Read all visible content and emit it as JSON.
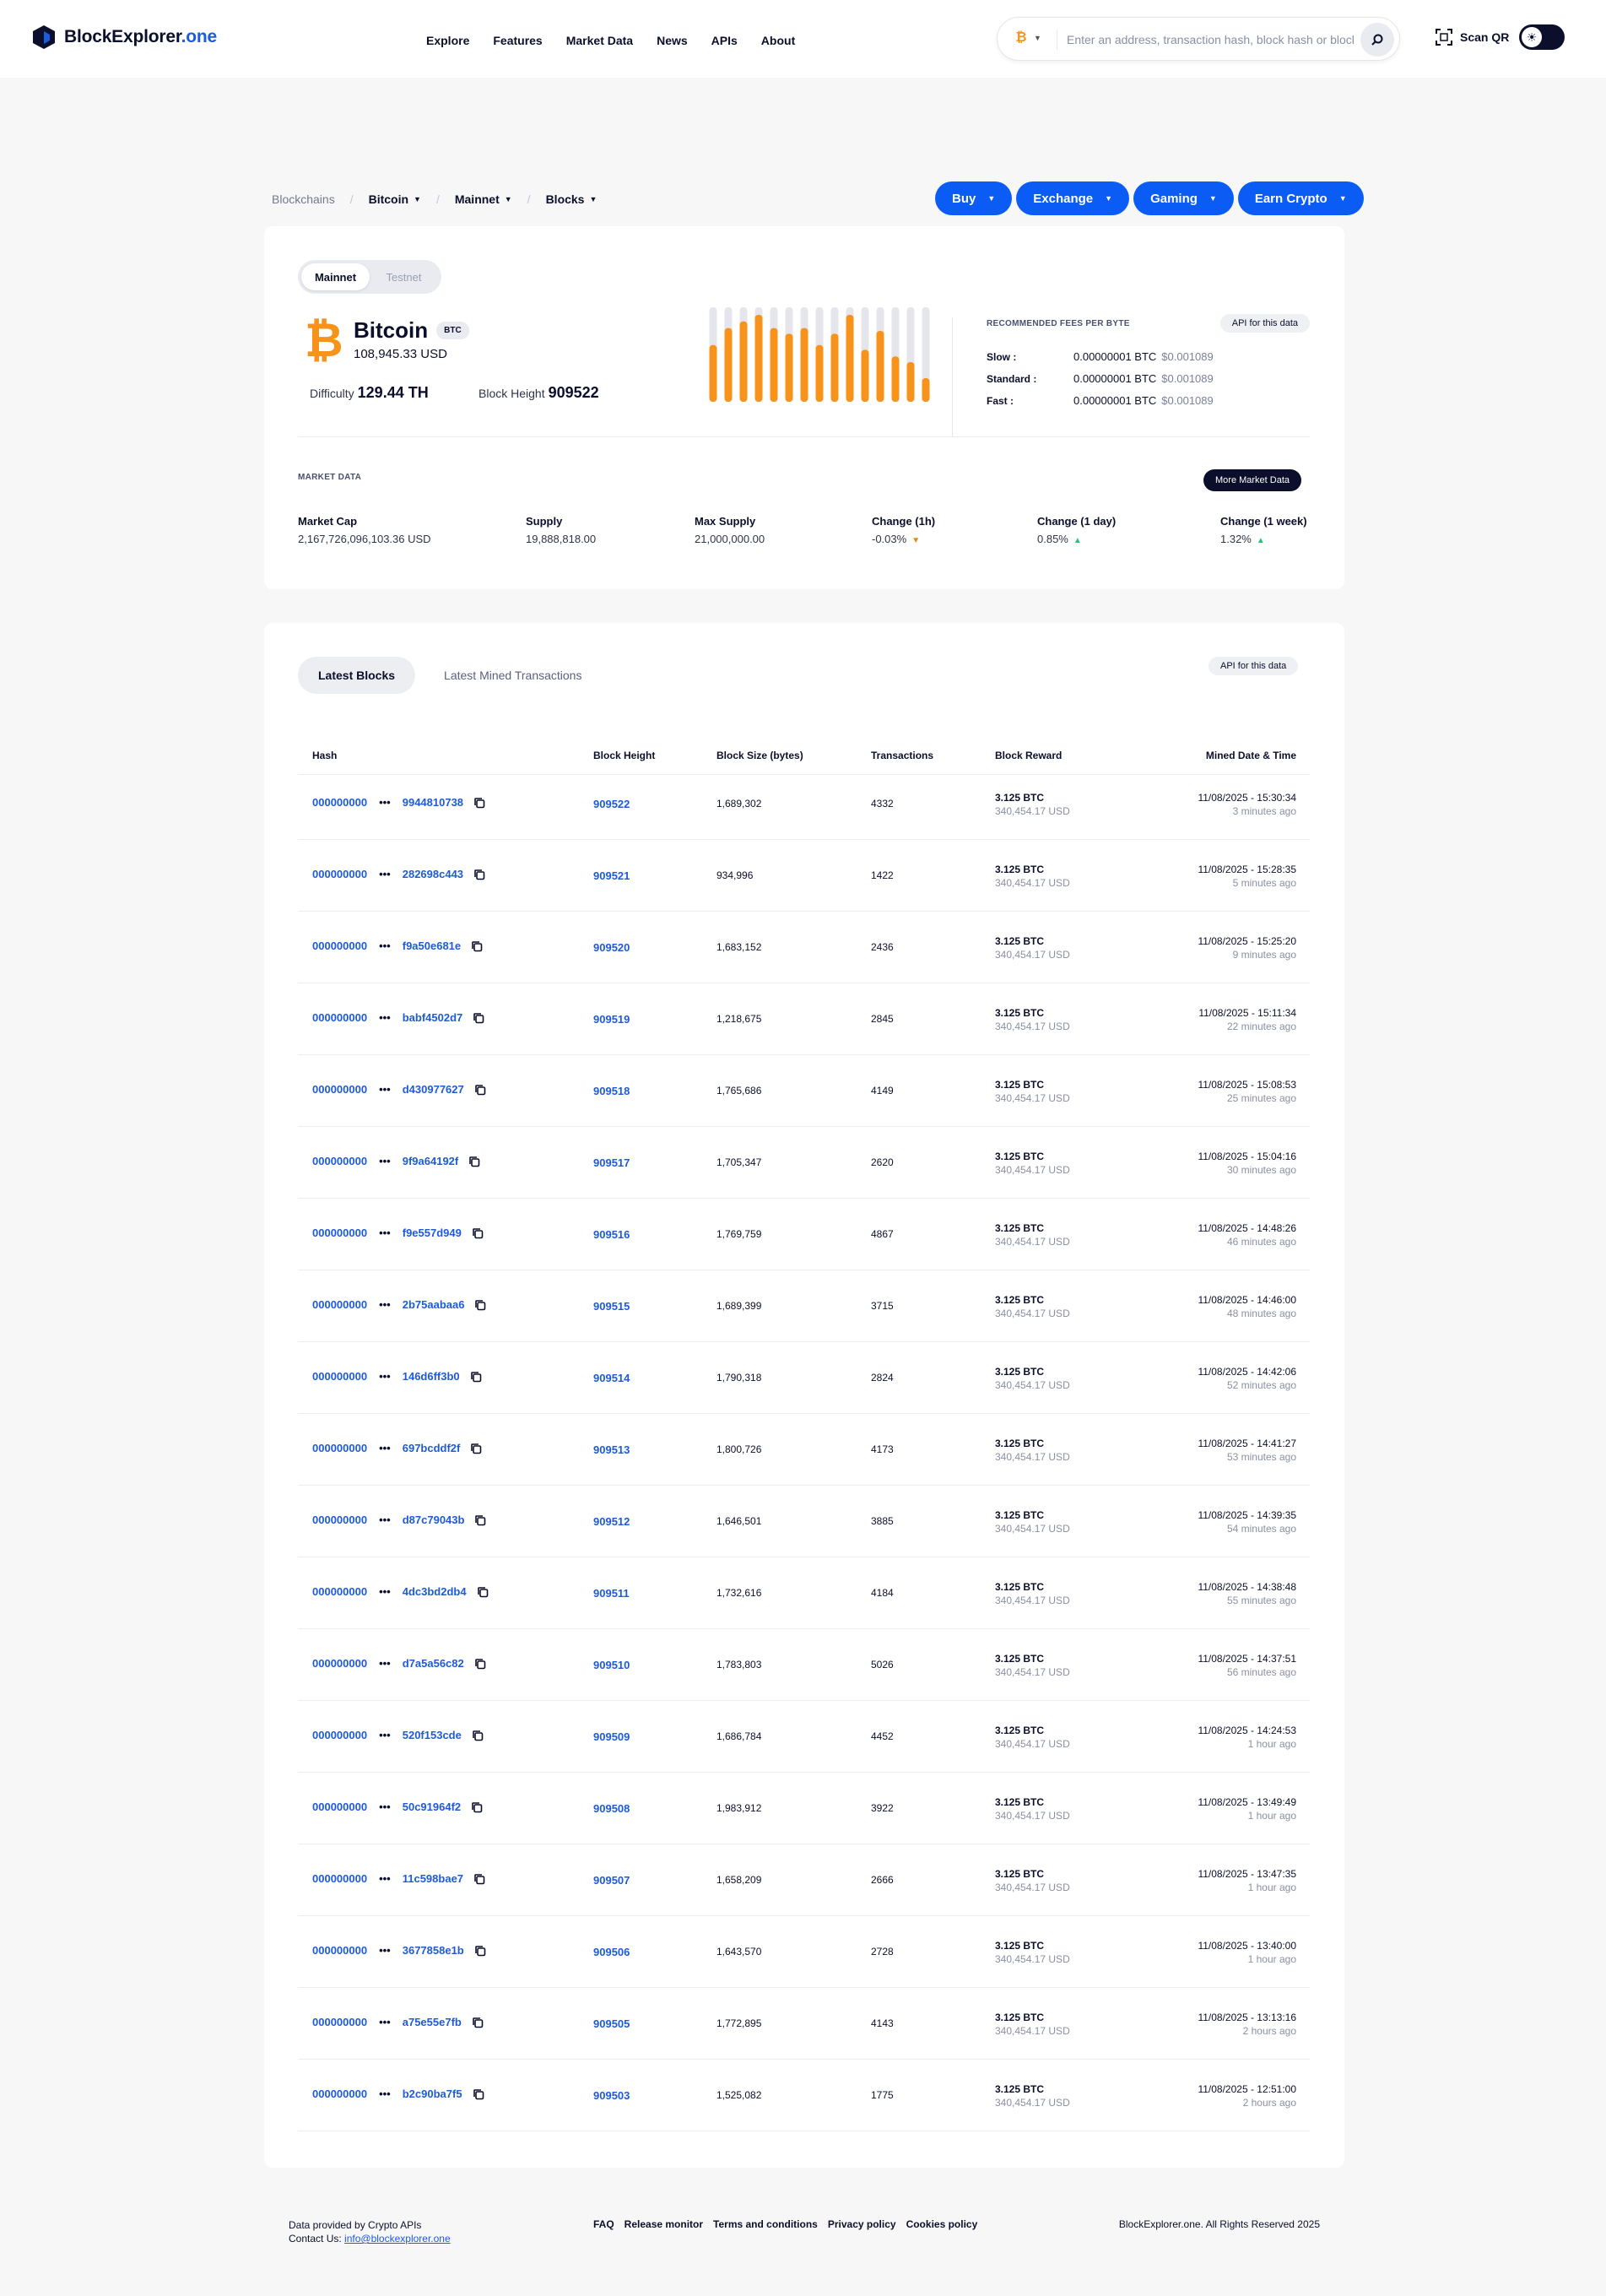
{
  "header": {
    "logo_main": "BlockExplorer",
    "logo_accent": ".one",
    "nav": [
      "Explore",
      "Features",
      "Market Data",
      "News",
      "APIs",
      "About"
    ],
    "search_placeholder": "Enter an address, transaction hash, block hash or block",
    "scan_qr": "Scan QR"
  },
  "breadcrumb": {
    "root": "Blockchains",
    "chain": "Bitcoin",
    "network": "Mainnet",
    "section": "Blocks"
  },
  "actions": [
    "Buy",
    "Exchange",
    "Gaming",
    "Earn Crypto"
  ],
  "coin": {
    "network_tabs": [
      "Mainnet",
      "Testnet"
    ],
    "name": "Bitcoin",
    "ticker": "BTC",
    "price": "108,945.33 USD",
    "difficulty_label": "Difficulty",
    "difficulty_value": "129.44 TH",
    "block_height_label": "Block Height",
    "block_height_value": "909522",
    "bars": [
      0.6,
      0.78,
      0.85,
      0.92,
      0.78,
      0.72,
      0.78,
      0.6,
      0.72,
      0.92,
      0.55,
      0.75,
      0.48,
      0.42,
      0.25
    ]
  },
  "fees": {
    "title": "RECOMMENDED FEES PER BYTE",
    "api_label": "API for this data",
    "rows": [
      {
        "label": "Slow :",
        "btc": "0.00000001 BTC",
        "usd": "$0.001089"
      },
      {
        "label": "Standard :",
        "btc": "0.00000001 BTC",
        "usd": "$0.001089"
      },
      {
        "label": "Fast :",
        "btc": "0.00000001 BTC",
        "usd": "$0.001089"
      }
    ]
  },
  "market": {
    "title": "MARKET DATA",
    "more_label": "More Market Data",
    "cap_label": "Market Cap",
    "cap_value": "2,167,726,096,103.36 USD",
    "supply_label": "Supply",
    "supply_value": "19,888,818.00",
    "max_label": "Max Supply",
    "max_value": "21,000,000.00",
    "ch1h_label": "Change (1h)",
    "ch1h_value": "-0.03%",
    "ch1d_label": "Change (1 day)",
    "ch1d_value": "0.85%",
    "ch1w_label": "Change (1 week)",
    "ch1w_value": "1.32%"
  },
  "blocks": {
    "tabs": [
      "Latest Blocks",
      "Latest Mined Transactions"
    ],
    "api_label": "API for this data",
    "columns": [
      "Hash",
      "Block Height",
      "Block Size (bytes)",
      "Transactions",
      "Block Reward",
      "Mined Date & Time"
    ],
    "hash_prefix": "000000000",
    "hash_dots": "•••",
    "rows": [
      {
        "hash": "9944810738",
        "height": "909522",
        "size": "1,689,302",
        "txs": "4332",
        "reward_btc": "3.125 BTC",
        "reward_usd": "340,454.17 USD",
        "date": "11/08/2025 - 15:30:34",
        "ago": "3 minutes ago"
      },
      {
        "hash": "282698c443",
        "height": "909521",
        "size": "934,996",
        "txs": "1422",
        "reward_btc": "3.125 BTC",
        "reward_usd": "340,454.17 USD",
        "date": "11/08/2025 - 15:28:35",
        "ago": "5 minutes ago"
      },
      {
        "hash": "f9a50e681e",
        "height": "909520",
        "size": "1,683,152",
        "txs": "2436",
        "reward_btc": "3.125 BTC",
        "reward_usd": "340,454.17 USD",
        "date": "11/08/2025 - 15:25:20",
        "ago": "9 minutes ago"
      },
      {
        "hash": "babf4502d7",
        "height": "909519",
        "size": "1,218,675",
        "txs": "2845",
        "reward_btc": "3.125 BTC",
        "reward_usd": "340,454.17 USD",
        "date": "11/08/2025 - 15:11:34",
        "ago": "22 minutes ago"
      },
      {
        "hash": "d430977627",
        "height": "909518",
        "size": "1,765,686",
        "txs": "4149",
        "reward_btc": "3.125 BTC",
        "reward_usd": "340,454.17 USD",
        "date": "11/08/2025 - 15:08:53",
        "ago": "25 minutes ago"
      },
      {
        "hash": "9f9a64192f",
        "height": "909517",
        "size": "1,705,347",
        "txs": "2620",
        "reward_btc": "3.125 BTC",
        "reward_usd": "340,454.17 USD",
        "date": "11/08/2025 - 15:04:16",
        "ago": "30 minutes ago"
      },
      {
        "hash": "f9e557d949",
        "height": "909516",
        "size": "1,769,759",
        "txs": "4867",
        "reward_btc": "3.125 BTC",
        "reward_usd": "340,454.17 USD",
        "date": "11/08/2025 - 14:48:26",
        "ago": "46 minutes ago"
      },
      {
        "hash": "2b75aabaa6",
        "height": "909515",
        "size": "1,689,399",
        "txs": "3715",
        "reward_btc": "3.125 BTC",
        "reward_usd": "340,454.17 USD",
        "date": "11/08/2025 - 14:46:00",
        "ago": "48 minutes ago"
      },
      {
        "hash": "146d6ff3b0",
        "height": "909514",
        "size": "1,790,318",
        "txs": "2824",
        "reward_btc": "3.125 BTC",
        "reward_usd": "340,454.17 USD",
        "date": "11/08/2025 - 14:42:06",
        "ago": "52 minutes ago"
      },
      {
        "hash": "697bcddf2f",
        "height": "909513",
        "size": "1,800,726",
        "txs": "4173",
        "reward_btc": "3.125 BTC",
        "reward_usd": "340,454.17 USD",
        "date": "11/08/2025 - 14:41:27",
        "ago": "53 minutes ago"
      },
      {
        "hash": "d87c79043b",
        "height": "909512",
        "size": "1,646,501",
        "txs": "3885",
        "reward_btc": "3.125 BTC",
        "reward_usd": "340,454.17 USD",
        "date": "11/08/2025 - 14:39:35",
        "ago": "54 minutes ago"
      },
      {
        "hash": "4dc3bd2db4",
        "height": "909511",
        "size": "1,732,616",
        "txs": "4184",
        "reward_btc": "3.125 BTC",
        "reward_usd": "340,454.17 USD",
        "date": "11/08/2025 - 14:38:48",
        "ago": "55 minutes ago"
      },
      {
        "hash": "d7a5a56c82",
        "height": "909510",
        "size": "1,783,803",
        "txs": "5026",
        "reward_btc": "3.125 BTC",
        "reward_usd": "340,454.17 USD",
        "date": "11/08/2025 - 14:37:51",
        "ago": "56 minutes ago"
      },
      {
        "hash": "520f153cde",
        "height": "909509",
        "size": "1,686,784",
        "txs": "4452",
        "reward_btc": "3.125 BTC",
        "reward_usd": "340,454.17 USD",
        "date": "11/08/2025 - 14:24:53",
        "ago": "1 hour ago"
      },
      {
        "hash": "50c91964f2",
        "height": "909508",
        "size": "1,983,912",
        "txs": "3922",
        "reward_btc": "3.125 BTC",
        "reward_usd": "340,454.17 USD",
        "date": "11/08/2025 - 13:49:49",
        "ago": "1 hour ago"
      },
      {
        "hash": "11c598bae7",
        "height": "909507",
        "size": "1,658,209",
        "txs": "2666",
        "reward_btc": "3.125 BTC",
        "reward_usd": "340,454.17 USD",
        "date": "11/08/2025 - 13:47:35",
        "ago": "1 hour ago"
      },
      {
        "hash": "3677858e1b",
        "height": "909506",
        "size": "1,643,570",
        "txs": "2728",
        "reward_btc": "3.125 BTC",
        "reward_usd": "340,454.17 USD",
        "date": "11/08/2025 - 13:40:00",
        "ago": "1 hour ago"
      },
      {
        "hash": "a75e55e7fb",
        "height": "909505",
        "size": "1,772,895",
        "txs": "4143",
        "reward_btc": "3.125 BTC",
        "reward_usd": "340,454.17 USD",
        "date": "11/08/2025 - 13:13:16",
        "ago": "2 hours ago"
      },
      {
        "hash": "b2c90ba7f5",
        "height": "909503",
        "size": "1,525,082",
        "txs": "1775",
        "reward_btc": "3.125 BTC",
        "reward_usd": "340,454.17 USD",
        "date": "11/08/2025 - 12:51:00",
        "ago": "2 hours ago"
      }
    ]
  },
  "footer": {
    "provided": "Data provided by Crypto APIs",
    "contact_label": "Contact Us:",
    "contact_email": "info@blockexplorer.one",
    "links": [
      "FAQ",
      "Release monitor",
      "Terms and conditions",
      "Privacy policy",
      "Cookies policy"
    ],
    "copyright": "BlockExplorer.one. All Rights Reserved 2025"
  },
  "colors": {
    "accent": "#0a5cf5",
    "link": "#1d5bd8",
    "bitcoin": "#f7931a",
    "dark": "#0b0f2b"
  }
}
